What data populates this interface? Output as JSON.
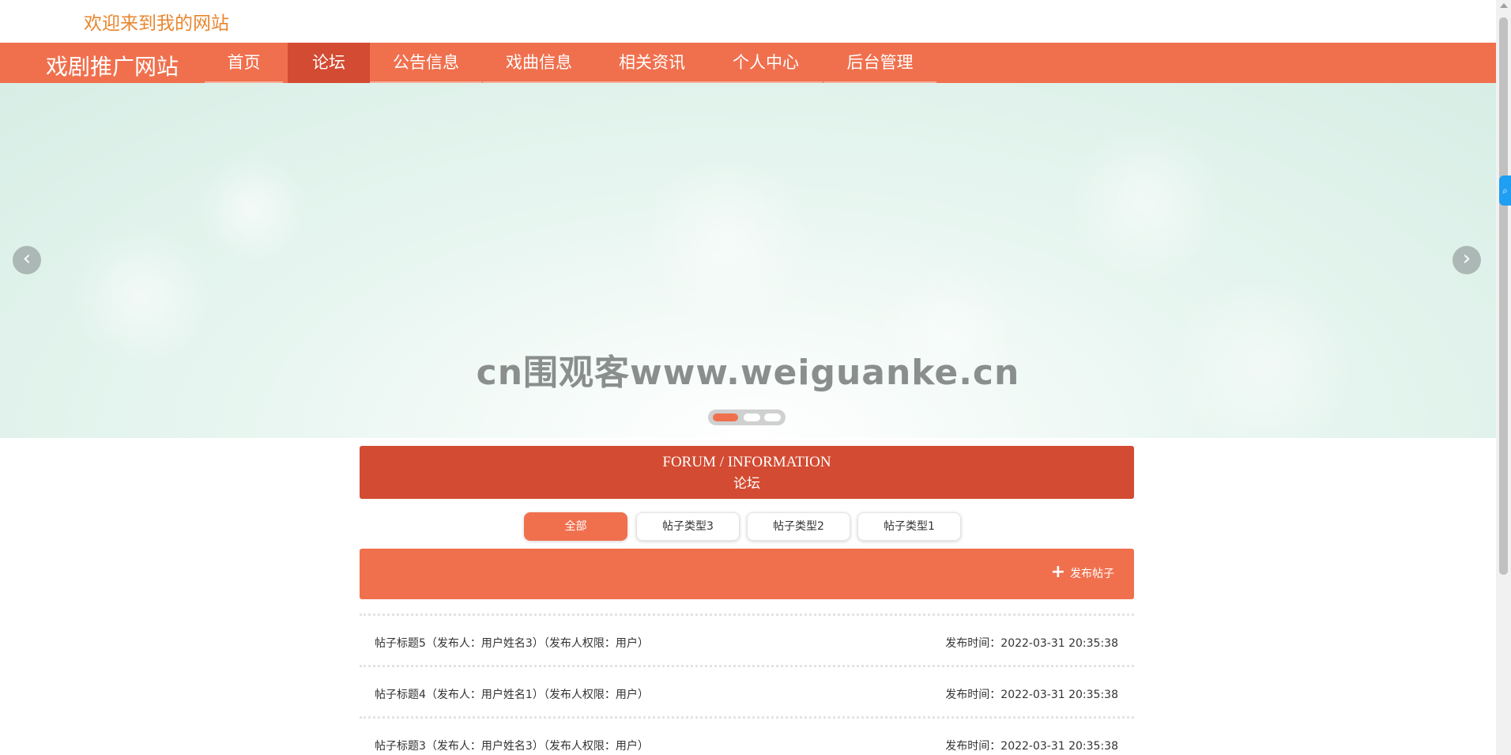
{
  "header": {
    "welcome": "欢迎来到我的网站"
  },
  "nav": {
    "brand": "戏剧推广网站",
    "items": [
      {
        "label": "首页"
      },
      {
        "label": "论坛"
      },
      {
        "label": "公告信息"
      },
      {
        "label": "戏曲信息"
      },
      {
        "label": "相关资讯"
      },
      {
        "label": "个人中心"
      },
      {
        "label": "后台管理"
      }
    ],
    "active_index": 1
  },
  "banner": {
    "caption": "cn围观客www.weiguanke.cn",
    "prev_icon": "chevron-left-icon",
    "next_icon": "chevron-right-icon",
    "slide_count": 3,
    "active_slide": 0
  },
  "section": {
    "title_en": "FORUM / INFORMATION",
    "title_cn": "论坛"
  },
  "filters": [
    {
      "label": "全部"
    },
    {
      "label": "帖子类型3"
    },
    {
      "label": "帖子类型2"
    },
    {
      "label": "帖子类型1"
    }
  ],
  "actions": {
    "post_label": "发布帖子",
    "post_icon": "plus-icon"
  },
  "posts": [
    {
      "title": "帖子标题5（发布人：用户姓名3）（发布人权限：用户）",
      "time": "发布时间：2022-03-31 20:35:38"
    },
    {
      "title": "帖子标题4（发布人：用户姓名1）（发布人权限：用户）",
      "time": "发布时间：2022-03-31 20:35:38"
    },
    {
      "title": "帖子标题3（发布人：用户姓名3）（发布人权限：用户）",
      "time": "发布时间：2022-03-31 20:35:38"
    }
  ],
  "colors": {
    "primary": "#f0704e",
    "primary_dark": "#d34b32",
    "welcome": "#e8862f",
    "banner_bg": "#d7eee5"
  }
}
